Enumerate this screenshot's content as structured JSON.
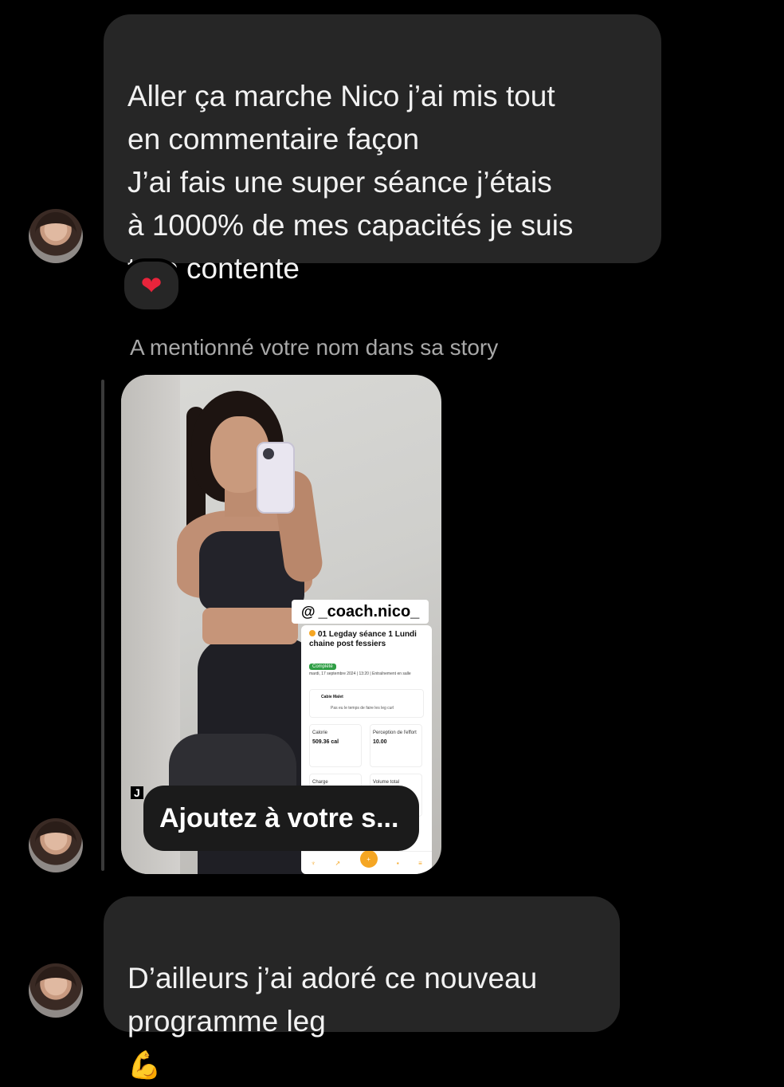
{
  "messages": [
    {
      "text": "Aller ça marche Nico j’ai mis tout\nen commentaire façon\nJ’ai fais une super séance j’étais\nà 1000% de mes capacités je suis\ntrop contente"
    },
    {
      "text": "D’ailleurs j’ai adoré ce nouveau\nprogramme leg"
    }
  ],
  "reaction": {
    "emoji": "❤"
  },
  "mention_note": "A mentionné votre nom dans sa story",
  "story": {
    "tag": "_coach.nico_",
    "side_letter": "J",
    "cta": "Ajoutez à votre s...",
    "card": {
      "title": "01 Legday séance 1 Lundi chaine post fessiers",
      "badge": "Complété",
      "date": "mardi, 17 septembre 2024 | 13:20 | Entraînement en salle",
      "note_name": "Cabie Malet",
      "note_text": "Pas eu le temps de faire les leg curl",
      "metrics": [
        {
          "label": "Calorie",
          "value": "509.36 cal"
        },
        {
          "label": "Perception de l'effort",
          "value": "10.00"
        },
        {
          "label": "Charge",
          "value": ""
        },
        {
          "label": "Volume total",
          "value": ""
        }
      ]
    }
  },
  "emoji_muscle": "💪"
}
